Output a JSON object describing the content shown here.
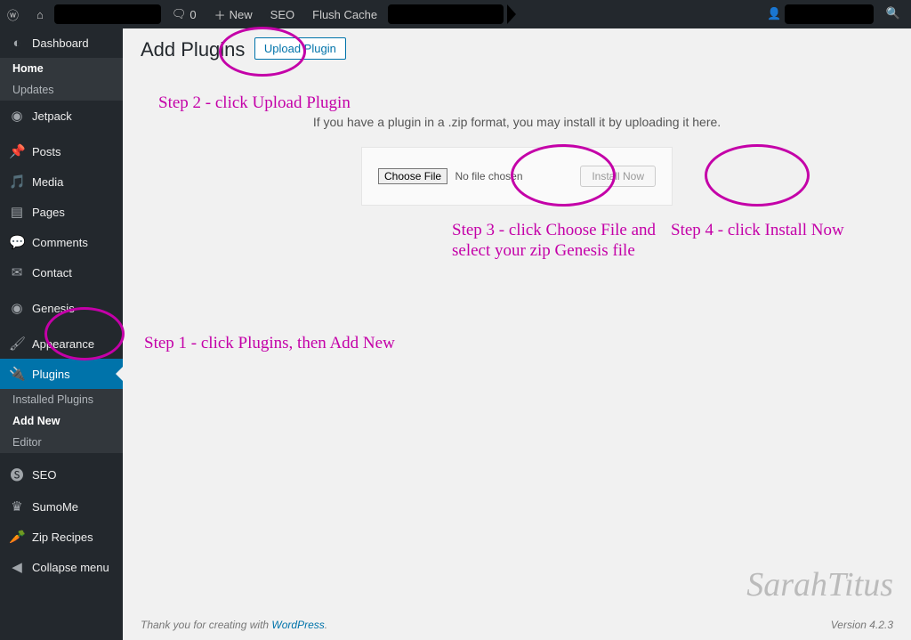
{
  "adminbar": {
    "comments_count": "0",
    "new_label": "New",
    "seo_label": "SEO",
    "flush_label": "Flush Cache"
  },
  "sidebar": {
    "dashboard": "Dashboard",
    "dashboard_sub": {
      "home": "Home",
      "updates": "Updates"
    },
    "jetpack": "Jetpack",
    "posts": "Posts",
    "media": "Media",
    "pages": "Pages",
    "comments": "Comments",
    "contact": "Contact",
    "genesis": "Genesis",
    "appearance": "Appearance",
    "plugins": "Plugins",
    "plugins_sub": {
      "installed": "Installed Plugins",
      "addnew": "Add New",
      "editor": "Editor"
    },
    "seo": "SEO",
    "sumome": "SumoMe",
    "zip": "Zip Recipes",
    "collapse": "Collapse menu"
  },
  "page": {
    "title": "Add Plugins",
    "upload_btn": "Upload Plugin",
    "blurb": "If you have a plugin in a .zip format, you may install it by uploading it here.",
    "choose_file": "Choose File",
    "no_file": "No file chosen",
    "install": "Install Now"
  },
  "footer": {
    "thanks_pre": "Thank you for creating with ",
    "wp": "WordPress",
    "thanks_post": ".",
    "version": "Version 4.2.3"
  },
  "annotations": {
    "step1": "Step 1 - click Plugins, then Add New",
    "step2": "Step 2 - click Upload Plugin",
    "step3": "Step 3 - click Choose File and select your zip Genesis file",
    "step4": "Step 4 - click Install Now",
    "watermark": "SarahTitus"
  }
}
